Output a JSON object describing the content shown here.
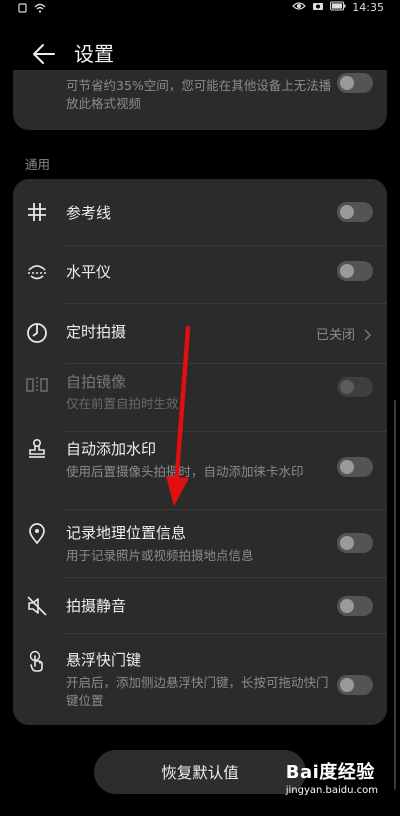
{
  "status_bar": {
    "time": "14:35"
  },
  "header": {
    "title": "设置"
  },
  "top_card": {
    "description": "可节省约35%空间，您可能在其他设备上无法播放此格式视频"
  },
  "section": {
    "label": "通用"
  },
  "settings": [
    {
      "label": "参考线",
      "icon": "grid-hash-icon",
      "control": "toggle"
    },
    {
      "label": "水平仪",
      "icon": "level-icon",
      "control": "toggle"
    },
    {
      "label": "定时拍摄",
      "icon": "timer-icon",
      "control": "value",
      "value": "已关闭"
    },
    {
      "label": "自拍镜像",
      "sub": "仅在前置自拍时生效",
      "icon": "mirror-icon",
      "control": "toggle",
      "disabled": true
    },
    {
      "label": "自动添加水印",
      "sub": "使用后置摄像头拍摄时，自动添加徕卡水印",
      "icon": "stamp-icon",
      "control": "toggle"
    },
    {
      "label": "记录地理位置信息",
      "sub": "用于记录照片或视频拍摄地点信息",
      "icon": "location-pin-icon",
      "control": "toggle"
    },
    {
      "label": "拍摄静音",
      "icon": "mute-icon",
      "control": "toggle"
    },
    {
      "label": "悬浮快门键",
      "sub": "开启后，添加侧边悬浮快门键，长按可拖动快门键位置",
      "icon": "touch-icon",
      "control": "toggle"
    }
  ],
  "reset_button": {
    "label": "恢复默认值"
  },
  "watermark": {
    "logo": "Bai度经验",
    "url": "jingyan.baidu.com"
  }
}
